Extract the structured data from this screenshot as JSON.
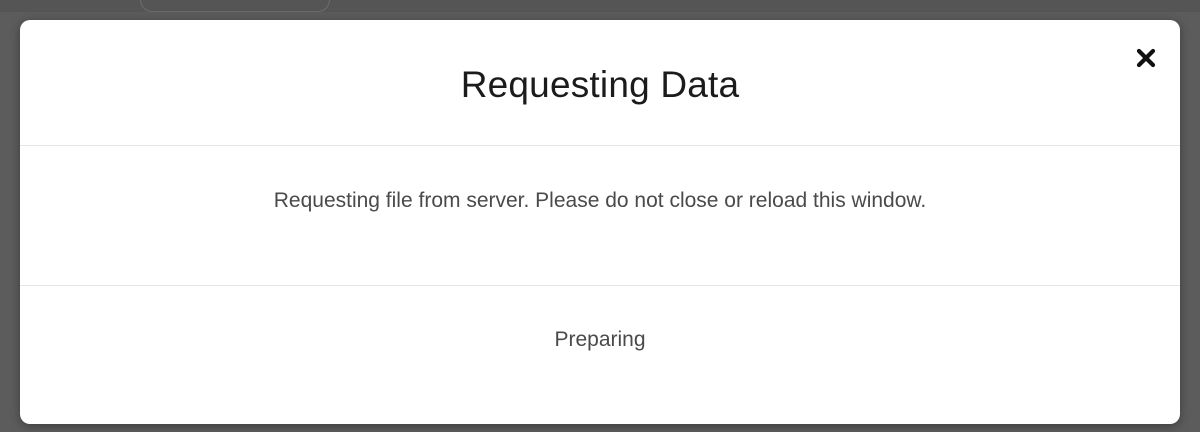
{
  "dialog": {
    "title": "Requesting Data",
    "message": "Requesting file from server. Please do not close or reload this window.",
    "status": "Preparing",
    "close_icon": "close-icon"
  },
  "colors": {
    "backdrop": "#5c5c5c",
    "modal_background": "#ffffff",
    "title_text": "#1b1b1b",
    "body_text": "#4a4a4a",
    "divider": "#e6e6e6"
  }
}
